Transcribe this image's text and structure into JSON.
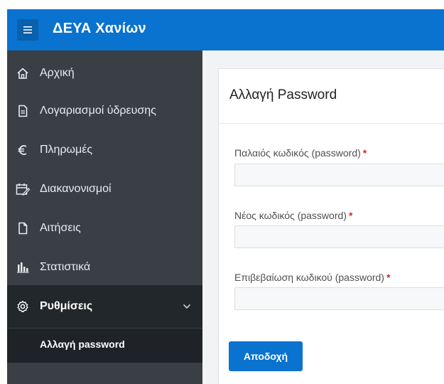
{
  "app": {
    "title": "ΔΕΥΑ Χανίων",
    "brand_color": "#0a72cf"
  },
  "sidebar": {
    "items": [
      {
        "label": "Αρχική",
        "icon": "home-icon"
      },
      {
        "label": "Λογαριασμοί ύδρευσης",
        "icon": "document-icon"
      },
      {
        "label": "Πληρωμές",
        "icon": "euro-icon"
      },
      {
        "label": "Διακανονισμοί",
        "icon": "calendar-edit-icon"
      },
      {
        "label": "Αιτήσεις",
        "icon": "file-icon"
      },
      {
        "label": "Στατιστικά",
        "icon": "bar-chart-icon"
      },
      {
        "label": "Ρυθμίσεις",
        "icon": "gear-icon",
        "expanded": true
      }
    ],
    "subitems": [
      {
        "label": "Αλλαγή password"
      }
    ]
  },
  "form": {
    "title": "Αλλαγή Password",
    "fields": [
      {
        "label": "Παλαιός κωδικός (password)",
        "required_mark": "*",
        "value": ""
      },
      {
        "label": "Νέος κωδικός (password)",
        "required_mark": "*",
        "value": ""
      },
      {
        "label": "Επιβεβαίωση κωδικού (password)",
        "required_mark": "*",
        "value": ""
      }
    ],
    "submit_label": "Αποδοχή"
  }
}
